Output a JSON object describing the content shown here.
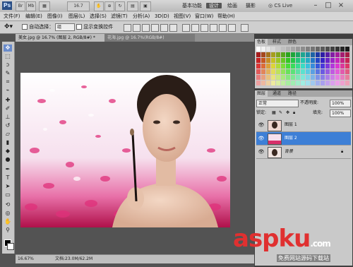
{
  "app": {
    "logo": "Ps",
    "zoom_widget": "16.7",
    "workspace": "基本功能",
    "workspace_active": "设计",
    "workspace_more": [
      "绘画",
      "摄影"
    ],
    "cs_live": "CS Live"
  },
  "menu": [
    "文件(F)",
    "编辑(E)",
    "图像(I)",
    "图层(L)",
    "选择(S)",
    "滤镜(T)",
    "分析(A)",
    "3D(D)",
    "视图(V)",
    "窗口(W)",
    "帮助(H)"
  ],
  "options": {
    "auto_select_label": "自动选择：",
    "auto_select_value": "组",
    "show_transform_label": "显示变换控件"
  },
  "tabs": [
    "美女.jpg @ 16.7% (图层 2, RGB/8#) *",
    "花海.jpg @ 16.7%(RGB/8#)"
  ],
  "status": {
    "zoom": "16.67%",
    "doc": "文档:23.0M/62.2M"
  },
  "swatch_tabs": [
    "色板",
    "样式",
    "颜色"
  ],
  "layers_tabs": [
    "图层",
    "通道",
    "路径"
  ],
  "layers_panel": {
    "blend_mode": "正常",
    "opacity_label": "不透明度:",
    "opacity_value": "100%",
    "lock_label": "锁定:",
    "fill_label": "填充:",
    "fill_value": "100%"
  },
  "layers": [
    {
      "name": "图层 1",
      "selected": false
    },
    {
      "name": "图层 2",
      "selected": true
    },
    {
      "name": "背景",
      "selected": false
    }
  ],
  "watermark": {
    "main": "aspku",
    "tld": ".com",
    "sub": "免费网站源码下载站"
  },
  "colors": {
    "accent": "#3d7fd6",
    "petal": "#e0307a",
    "watermark": "#e03030"
  }
}
